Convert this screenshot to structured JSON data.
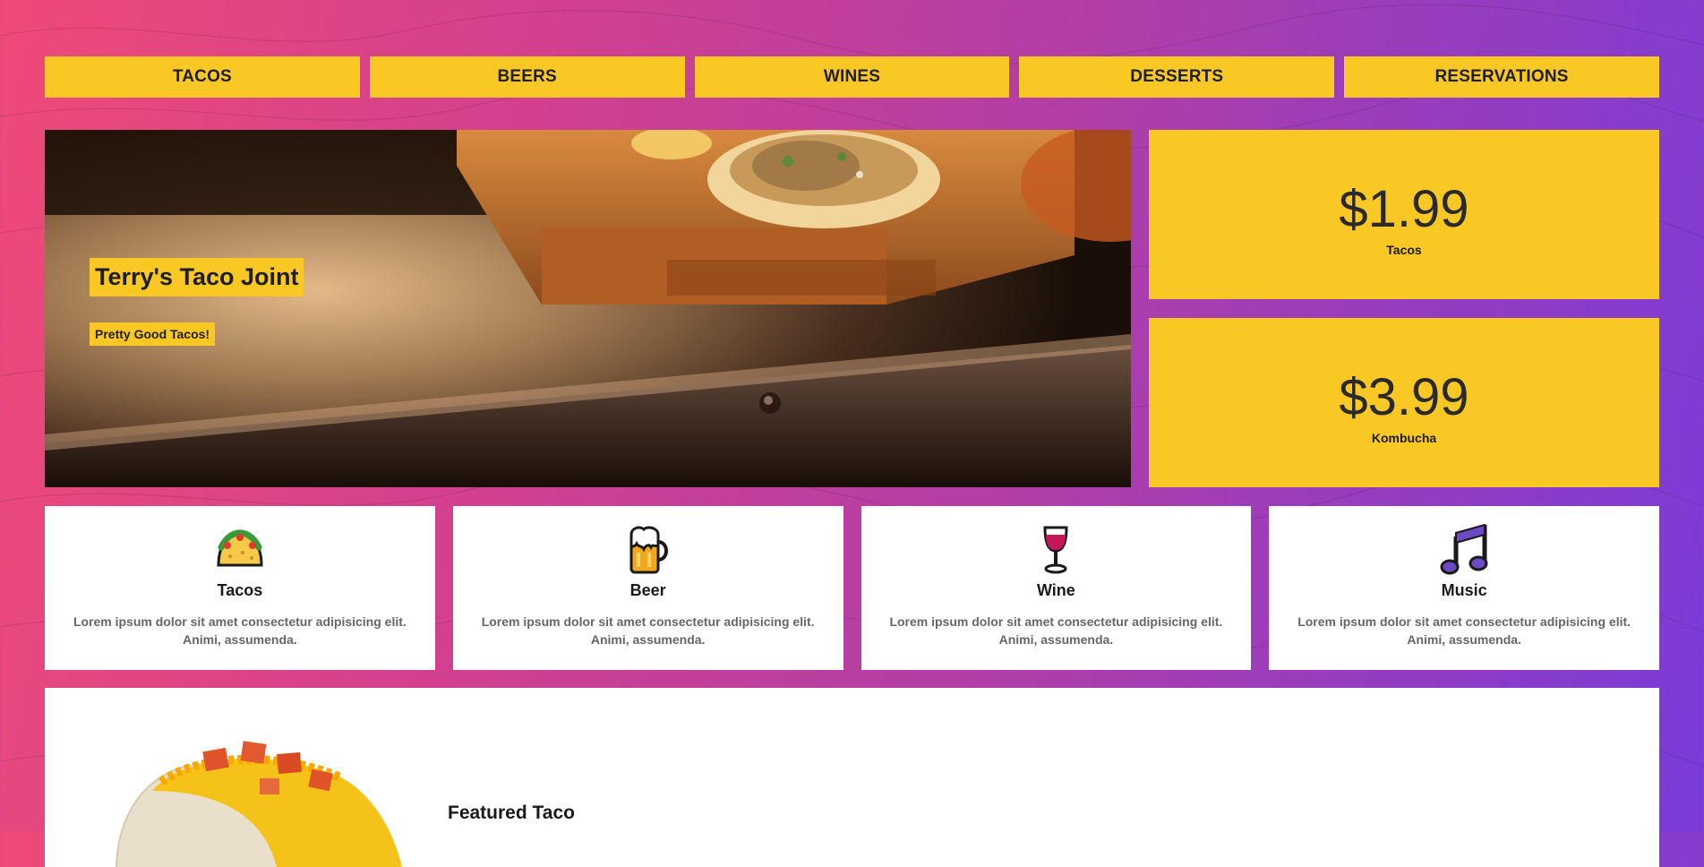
{
  "nav": {
    "items": [
      {
        "label": "TACOS"
      },
      {
        "label": "BEERS"
      },
      {
        "label": "WINES"
      },
      {
        "label": "DESSERTS"
      },
      {
        "label": "RESERVATIONS"
      }
    ]
  },
  "hero": {
    "title": "Terry's Taco Joint",
    "subtitle": "Pretty Good Tacos!"
  },
  "prices": [
    {
      "amount": "$1.99",
      "label": "Tacos"
    },
    {
      "amount": "$3.99",
      "label": "Kombucha"
    }
  ],
  "features": [
    {
      "icon": "taco-icon",
      "title": "Tacos",
      "description": "Lorem ipsum dolor sit amet consectetur adipisicing elit. Animi, assumenda."
    },
    {
      "icon": "beer-icon",
      "title": "Beer",
      "description": "Lorem ipsum dolor sit amet consectetur adipisicing elit. Animi, assumenda."
    },
    {
      "icon": "wine-icon",
      "title": "Wine",
      "description": "Lorem ipsum dolor sit amet consectetur adipisicing elit. Animi, assumenda."
    },
    {
      "icon": "music-icon",
      "title": "Music",
      "description": "Lorem ipsum dolor sit amet consectetur adipisicing elit. Animi, assumenda."
    }
  ],
  "featured": {
    "title": "Featured Taco"
  },
  "colors": {
    "accent_yellow": "#f9c825",
    "gradient_start": "#ee4a78",
    "gradient_end": "#7a3bd8",
    "card_bg": "#ffffff"
  }
}
